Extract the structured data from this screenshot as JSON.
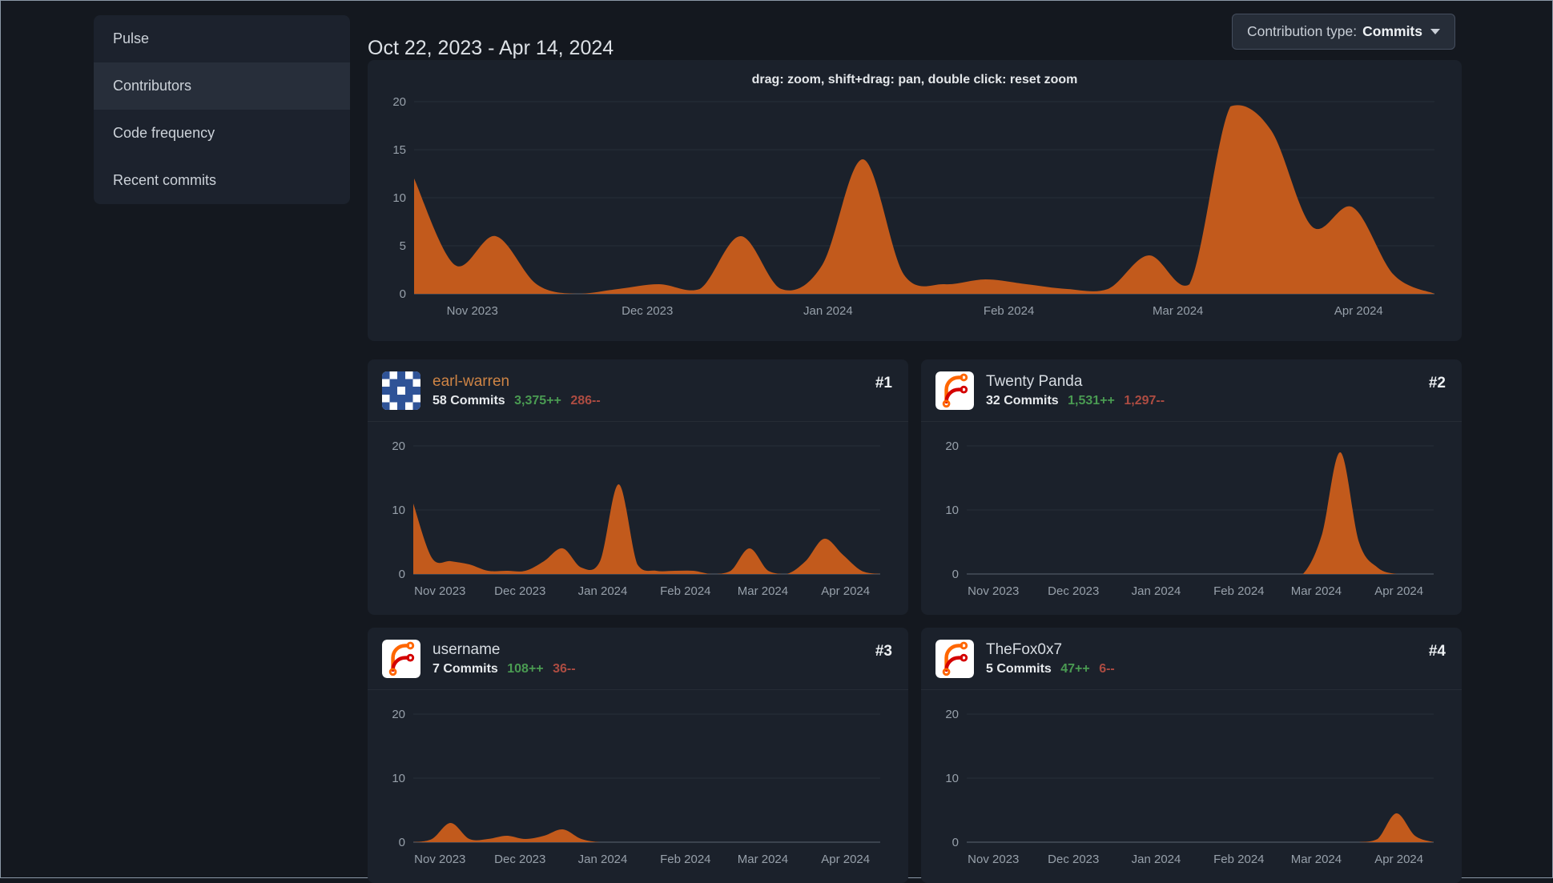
{
  "sidebar": {
    "items": [
      {
        "label": "Pulse",
        "active": false
      },
      {
        "label": "Contributors",
        "active": true
      },
      {
        "label": "Code frequency",
        "active": false
      },
      {
        "label": "Recent commits",
        "active": false
      }
    ]
  },
  "header": {
    "date_range": "Oct 22, 2023 - Apr 14, 2024",
    "contribution_type": {
      "label": "Contribution type:",
      "value": "Commits"
    }
  },
  "main_chart_hint": "drag: zoom, shift+drag: pan, double click: reset zoom",
  "contributors": [
    {
      "rank": "#1",
      "name": "earl-warren",
      "commits": "58 Commits",
      "additions": "3,375++",
      "deletions": "286--",
      "avatar": "identicon"
    },
    {
      "rank": "#2",
      "name": "Twenty Panda",
      "commits": "32 Commits",
      "additions": "1,531++",
      "deletions": "1,297--",
      "avatar": "forgejo-logo"
    },
    {
      "rank": "#3",
      "name": "username",
      "commits": "7 Commits",
      "additions": "108++",
      "deletions": "36--",
      "avatar": "forgejo-logo"
    },
    {
      "rank": "#4",
      "name": "TheFox0x7",
      "commits": "5 Commits",
      "additions": "47++",
      "deletions": "6--",
      "avatar": "forgejo-logo"
    }
  ],
  "chart_data": {
    "axis": {
      "x": [
        "2023-10-22",
        "2023-10-29",
        "2023-11-05",
        "2023-11-12",
        "2023-11-19",
        "2023-11-26",
        "2023-12-03",
        "2023-12-10",
        "2023-12-17",
        "2023-12-24",
        "2023-12-31",
        "2024-01-07",
        "2024-01-14",
        "2024-01-21",
        "2024-01-28",
        "2024-02-04",
        "2024-02-11",
        "2024-02-18",
        "2024-02-25",
        "2024-03-03",
        "2024-03-10",
        "2024-03-17",
        "2024-03-24",
        "2024-03-31",
        "2024-04-07",
        "2024-04-14"
      ],
      "x_tick_labels": [
        "Nov 2023",
        "Dec 2023",
        "Jan 2024",
        "Feb 2024",
        "Mar 2024",
        "Apr 2024"
      ],
      "x_tick_pos": [
        0.0571,
        0.2286,
        0.4057,
        0.5829,
        0.7486,
        0.9257
      ],
      "grid": true,
      "legend": "none"
    },
    "charts": [
      {
        "type": "area",
        "name": "All contributors commits per week",
        "values": [
          12,
          3,
          6,
          1,
          0,
          0.5,
          1,
          0.5,
          6,
          0.5,
          3,
          14,
          2,
          1,
          1.5,
          1,
          0.5,
          0.5,
          4,
          1,
          19.5,
          17,
          7,
          9,
          2,
          0
        ],
        "ylim": [
          0,
          20
        ],
        "y_ticks": [
          0,
          5,
          10,
          15,
          20
        ],
        "color": "#c25a1c"
      },
      {
        "type": "area",
        "name": "earl-warren commits per week",
        "values": [
          11,
          2.5,
          2,
          1.5,
          0.5,
          0.5,
          0.5,
          2,
          4,
          1,
          2,
          14,
          1.5,
          0.5,
          0.5,
          0.5,
          0,
          0.5,
          4,
          0.5,
          0,
          2,
          5.5,
          3,
          0.5,
          0
        ],
        "ylim": [
          0,
          20
        ],
        "y_ticks": [
          0,
          10,
          20
        ],
        "color": "#c25a1c"
      },
      {
        "type": "area",
        "name": "Twenty Panda commits per week",
        "values": [
          0,
          0,
          0,
          0,
          0,
          0,
          0,
          0,
          0,
          0,
          0,
          0,
          0,
          0,
          0,
          0,
          0,
          0,
          0,
          6,
          19,
          5,
          1,
          0,
          0,
          0
        ],
        "ylim": [
          0,
          20
        ],
        "y_ticks": [
          0,
          10,
          20
        ],
        "color": "#c25a1c"
      },
      {
        "type": "area",
        "name": "username commits per week",
        "values": [
          0,
          0.5,
          3,
          0.5,
          0.5,
          1,
          0.5,
          1,
          2,
          0.5,
          0,
          0,
          0,
          0,
          0,
          0,
          0,
          0,
          0,
          0,
          0,
          0,
          0,
          0,
          0,
          0
        ],
        "ylim": [
          0,
          20
        ],
        "y_ticks": [
          0,
          10,
          20
        ],
        "color": "#c25a1c"
      },
      {
        "type": "area",
        "name": "TheFox0x7 commits per week",
        "values": [
          0,
          0,
          0,
          0,
          0,
          0,
          0,
          0,
          0,
          0,
          0,
          0,
          0,
          0,
          0,
          0,
          0,
          0,
          0,
          0,
          0,
          0,
          0.5,
          4.5,
          1,
          0
        ],
        "ylim": [
          0,
          20
        ],
        "y_ticks": [
          0,
          10,
          20
        ],
        "color": "#c25a1c"
      }
    ]
  },
  "colors": {
    "page_bg": "#14181f",
    "panel_bg": "#1b212b",
    "accent_orange": "#c25a1c",
    "additions_green": "#4a9b52",
    "deletions_red": "#ad4c42",
    "identicon_blue": "#2f5397",
    "logo_orange": "#ff6600",
    "logo_red": "#d40000"
  }
}
